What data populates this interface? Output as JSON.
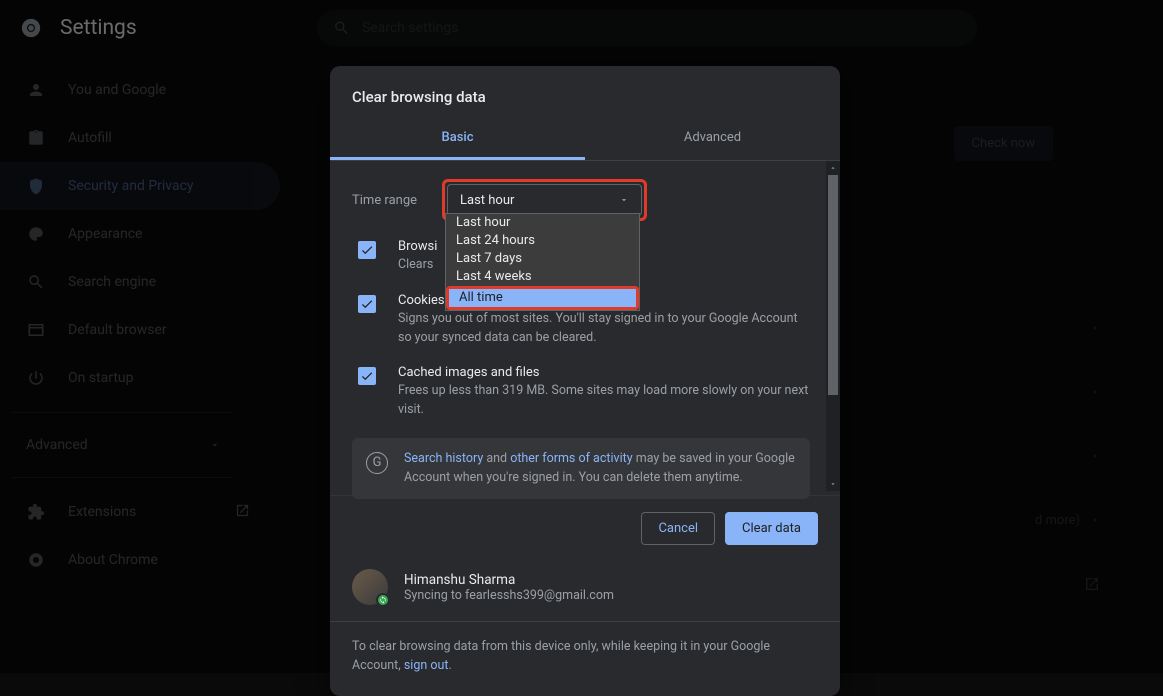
{
  "topbar": {
    "title": "Settings",
    "search_placeholder": "Search settings"
  },
  "sidebar": {
    "items": [
      {
        "label": "You and Google"
      },
      {
        "label": "Autofill"
      },
      {
        "label": "Security and Privacy"
      },
      {
        "label": "Appearance"
      },
      {
        "label": "Search engine"
      },
      {
        "label": "Default browser"
      },
      {
        "label": "On startup"
      }
    ],
    "advanced": "Advanced",
    "extensions": "Extensions",
    "about": "About Chrome"
  },
  "background": {
    "check_now": "Check now",
    "more_text": "d more)"
  },
  "dialog": {
    "title": "Clear browsing data",
    "tabs": {
      "basic": "Basic",
      "advanced": "Advanced"
    },
    "time_range_label": "Time range",
    "time_range_value": "Last hour",
    "time_options": {
      "o1": "Last hour",
      "o2": "Last 24 hours",
      "o3": "Last 7 days",
      "o4": "Last 4 weeks",
      "o5": "All time"
    },
    "opt1": {
      "title": "Browsi",
      "desc": "Clears"
    },
    "opt2": {
      "title": "Cookies and other site data",
      "desc": "Signs you out of most sites. You'll stay signed in to your Google Account so your synced data can be cleared."
    },
    "opt3": {
      "title": "Cached images and files",
      "desc": "Frees up less than 319 MB. Some sites may load more slowly on your next visit."
    },
    "info": {
      "a": "Search history",
      "mid": " and ",
      "b": "other forms of activity",
      "rest": " may be saved in your Google Account when you're signed in. You can delete them anytime."
    },
    "cancel": "Cancel",
    "clear": "Clear data",
    "account": {
      "name": "Himanshu Sharma",
      "sync_prefix": "Syncing to ",
      "email": "fearlesshs399@gmail.com"
    },
    "bottom": {
      "text": "To clear browsing data from this device only, while keeping it in your Google Account, ",
      "link": "sign out",
      "suffix": "."
    }
  }
}
